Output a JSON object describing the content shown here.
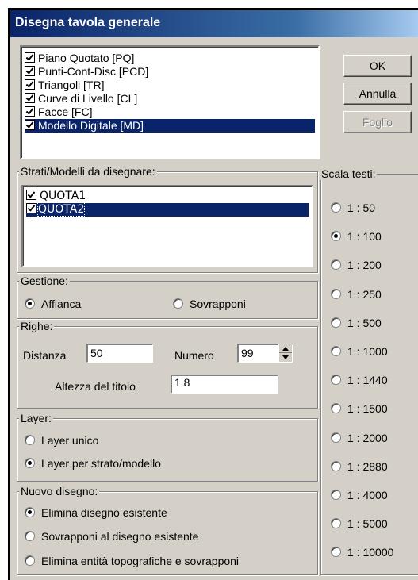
{
  "window": {
    "title": "Disegna tavola generale"
  },
  "tables_list": [
    {
      "label": "Piano Quotato [PQ]",
      "checked": true,
      "selected": false
    },
    {
      "label": "Punti-Cont-Disc [PCD]",
      "checked": true,
      "selected": false
    },
    {
      "label": "Triangoli [TR]",
      "checked": true,
      "selected": false
    },
    {
      "label": "Curve di Livello [CL]",
      "checked": true,
      "selected": false
    },
    {
      "label": "Facce [FC]",
      "checked": true,
      "selected": false
    },
    {
      "label": "Modello Digitale [MD]",
      "checked": true,
      "selected": true
    }
  ],
  "buttons": {
    "ok": "OK",
    "cancel": "Annulla",
    "sheet": "Foglio"
  },
  "layers_group": {
    "label": "Strati/Modelli da disegnare:",
    "items": [
      {
        "label": "QUOTA1",
        "checked": true,
        "selected": false
      },
      {
        "label": "QUOTA2",
        "checked": true,
        "selected": true
      }
    ]
  },
  "management": {
    "label": "Gestione:",
    "options": [
      {
        "label": "Affianca",
        "checked": true
      },
      {
        "label": "Sovrapponi",
        "checked": false
      }
    ]
  },
  "rows": {
    "label": "Righe:",
    "distance_label": "Distanza",
    "distance_value": "50",
    "number_label": "Numero",
    "number_value": "99",
    "title_height_label": "Altezza del titolo",
    "title_height_value": "1.8"
  },
  "layer": {
    "label": "Layer:",
    "options": [
      {
        "label": "Layer unico",
        "checked": false
      },
      {
        "label": "Layer per strato/modello",
        "checked": true
      }
    ]
  },
  "new_drawing": {
    "label": "Nuovo disegno:",
    "options": [
      {
        "label": "Elimina disegno esistente",
        "checked": true
      },
      {
        "label": "Sovrapponi al disegno esistente",
        "checked": false
      },
      {
        "label": "Elimina entità topografiche e sovrapponi",
        "checked": false
      }
    ]
  },
  "text_scale": {
    "label": "Scala testi:",
    "options": [
      {
        "label": "1 : 50",
        "checked": false
      },
      {
        "label": "1 : 100",
        "checked": true
      },
      {
        "label": "1 : 200",
        "checked": false
      },
      {
        "label": "1 : 250",
        "checked": false
      },
      {
        "label": "1 : 500",
        "checked": false
      },
      {
        "label": "1 : 1000",
        "checked": false
      },
      {
        "label": "1 : 1440",
        "checked": false
      },
      {
        "label": "1 : 1500",
        "checked": false
      },
      {
        "label": "1 : 2000",
        "checked": false
      },
      {
        "label": "1 : 2880",
        "checked": false
      },
      {
        "label": "1 : 4000",
        "checked": false
      },
      {
        "label": "1 : 5000",
        "checked": false
      },
      {
        "label": "1 : 10000",
        "checked": false
      }
    ]
  }
}
